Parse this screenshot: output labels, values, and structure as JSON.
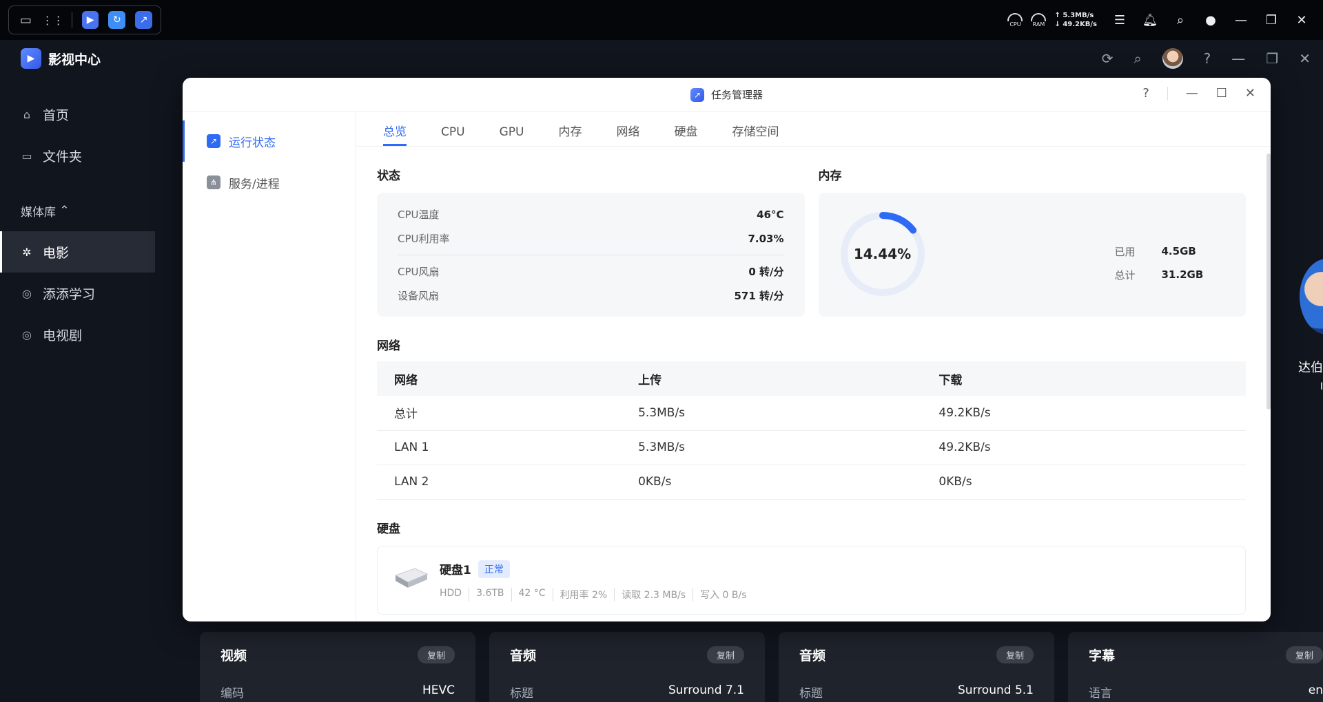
{
  "sysbar": {
    "cpu_label": "CPU",
    "ram_label": "RAM",
    "upload": "5.3MB/s",
    "download": "49.2KB/s",
    "icons": [
      "desktop-icon",
      "apps-grid-icon",
      "video-center-icon",
      "sync-icon",
      "task-manager-icon",
      "server-icon",
      "bell-icon",
      "search-icon",
      "user-icon",
      "minimize-icon",
      "restore-icon",
      "close-icon"
    ]
  },
  "app": {
    "title": "影视中心",
    "sidebar": {
      "items": [
        {
          "label": "首页",
          "icon": "home-icon"
        },
        {
          "label": "文件夹",
          "icon": "folder-icon"
        }
      ],
      "group": "媒体库",
      "library": [
        {
          "label": "电影",
          "icon": "film-icon",
          "active": true
        },
        {
          "label": "添添学习",
          "icon": "library-icon"
        },
        {
          "label": "电视剧",
          "icon": "library-icon"
        }
      ]
    },
    "cast_name": "达伯",
    "cast_sub": "I",
    "cards": [
      {
        "title": "视频",
        "copy": "复制",
        "key": "编码",
        "value": "HEVC"
      },
      {
        "title": "音频",
        "copy": "复制",
        "key": "标题",
        "value": "Surround 7.1"
      },
      {
        "title": "音频",
        "copy": "复制",
        "key": "标题",
        "value": "Surround 5.1"
      },
      {
        "title": "字幕",
        "copy": "复制",
        "key": "语言",
        "value": "en"
      }
    ]
  },
  "task_manager": {
    "title": "任务管理器",
    "nav": [
      {
        "label": "运行状态",
        "active": true
      },
      {
        "label": "服务/进程",
        "active": false
      }
    ],
    "tabs": [
      "总览",
      "CPU",
      "GPU",
      "内存",
      "网络",
      "硬盘",
      "存储空间"
    ],
    "active_tab": 0,
    "status": {
      "title": "状态",
      "rows": [
        {
          "label": "CPU温度",
          "value": "46°C"
        },
        {
          "label": "CPU利用率",
          "value": "7.03%"
        },
        {
          "label": "CPU风扇",
          "value": "0 转/分"
        },
        {
          "label": "设备风扇",
          "value": "571 转/分"
        }
      ]
    },
    "memory": {
      "title": "内存",
      "percent_text": "14.44%",
      "percent": 14.44,
      "used_label": "已用",
      "used": "4.5GB",
      "total_label": "总计",
      "total": "31.2GB",
      "ring_color": "#2f6af5",
      "track_color": "#e6ecf8"
    },
    "network": {
      "title": "网络",
      "headers": [
        "网络",
        "上传",
        "下载"
      ],
      "rows": [
        [
          "总计",
          "5.3MB/s",
          "49.2KB/s"
        ],
        [
          "LAN 1",
          "5.3MB/s",
          "49.2KB/s"
        ],
        [
          "LAN 2",
          "0KB/s",
          "0KB/s"
        ]
      ]
    },
    "disk": {
      "title": "硬盘",
      "name": "硬盘1",
      "status": "正常",
      "type": "HDD",
      "size": "3.6TB",
      "temp": "42 °C",
      "usage": "利用率 2%",
      "read": "读取 2.3 MB/s",
      "write": "写入 0 B/s"
    }
  }
}
